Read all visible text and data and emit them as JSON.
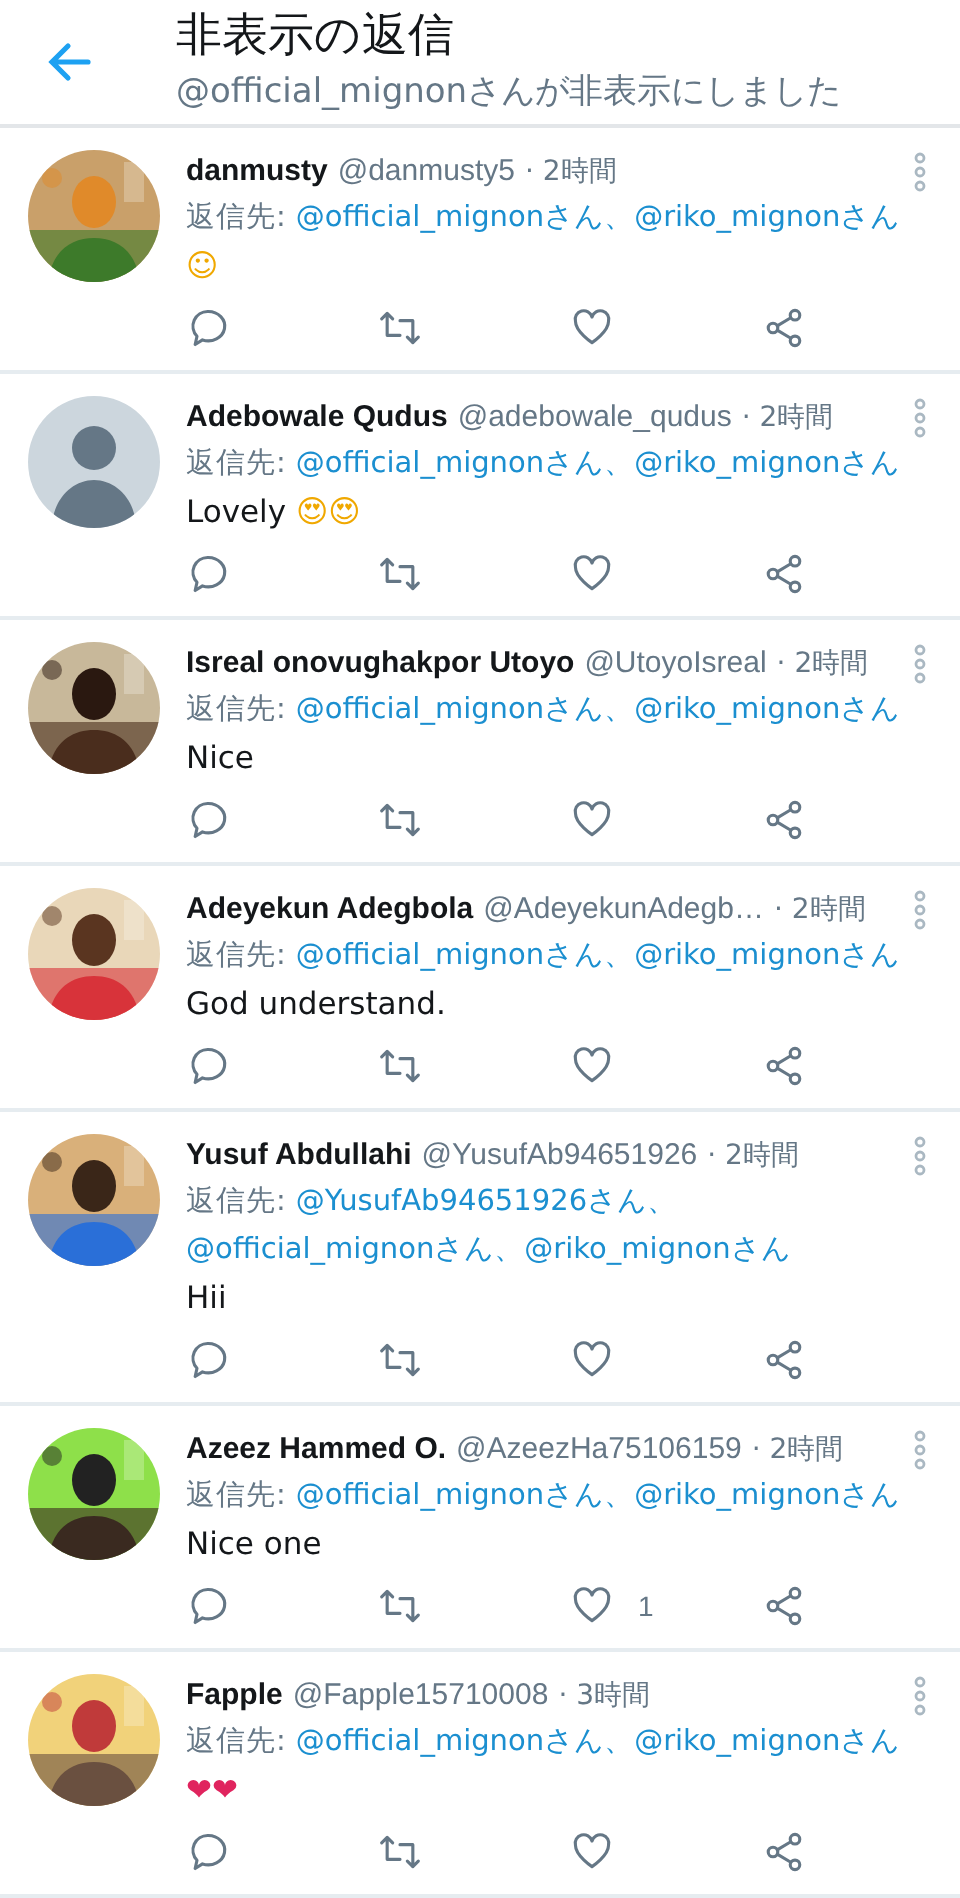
{
  "header": {
    "title": "非表示の返信",
    "subtitle": "@official_mignonさんが非表示にしました"
  },
  "tweets": [
    {
      "avatar": {
        "kind": "picture"
      },
      "name": "danmusty",
      "handle": "@danmusty5",
      "time": "· 2時間",
      "reply_label": "返信先:",
      "mentions": [
        "@official_mignonさん、",
        "@riko_mignonさん"
      ],
      "body": [
        {
          "kind": "emoji",
          "text": "☺"
        }
      ]
    },
    {
      "avatar": {
        "kind": "default"
      },
      "name": "Adebowale Qudus",
      "handle": "@adebowale_qudus",
      "time": "· 2時間",
      "reply_label": "返信先:",
      "mentions": [
        "@official_mignonさん、",
        "@riko_mignonさん"
      ],
      "body": [
        {
          "kind": "text",
          "text": "Lovely "
        },
        {
          "kind": "emoji",
          "text": "😍😍"
        }
      ]
    },
    {
      "avatar": {
        "kind": "picture"
      },
      "name": "Isreal onovughakpor Utoyo",
      "handle": "@UtoyoIsreal",
      "time": "· 2時間",
      "reply_label": "返信先:",
      "mentions": [
        "@official_mignonさん、",
        "@riko_mignonさん"
      ],
      "body": [
        {
          "kind": "text",
          "text": "Nice"
        }
      ]
    },
    {
      "avatar": {
        "kind": "picture"
      },
      "name": "Adeyekun Adegbola",
      "handle": "@AdeyekunAdegb…",
      "time": "· 2時間",
      "reply_label": "返信先:",
      "mentions": [
        "@official_mignonさん、",
        "@riko_mignonさん"
      ],
      "body": [
        {
          "kind": "text",
          "text": "God understand."
        }
      ]
    },
    {
      "avatar": {
        "kind": "picture"
      },
      "name": "Yusuf Abdullahi",
      "handle": "@YusufAb94651926",
      "time": "· 2時間",
      "reply_label": "返信先:",
      "mentions": [
        "@YusufAb94651926さん、",
        "@official_mignon",
        "さん、",
        "@riko_mignonさん"
      ],
      "body": [
        {
          "kind": "text",
          "text": "Hii"
        }
      ]
    },
    {
      "avatar": {
        "kind": "picture"
      },
      "name": "Azeez Hammed O.",
      "handle": "@AzeezHa75106159",
      "time": "· 2時間",
      "reply_label": "返信先:",
      "mentions": [
        "@official_mignonさん、",
        "@riko_mignonさん"
      ],
      "body": [
        {
          "kind": "text",
          "text": "Nice one"
        }
      ],
      "like_count": "1"
    },
    {
      "avatar": {
        "kind": "picture"
      },
      "name": "Fapple",
      "handle": "@Fapple15710008",
      "time": "· 3時間",
      "reply_label": "返信先:",
      "mentions": [
        "@official_mignonさん、",
        "@riko_mignonさん"
      ],
      "body": [
        {
          "kind": "heart",
          "text": "❤❤"
        }
      ]
    }
  ]
}
